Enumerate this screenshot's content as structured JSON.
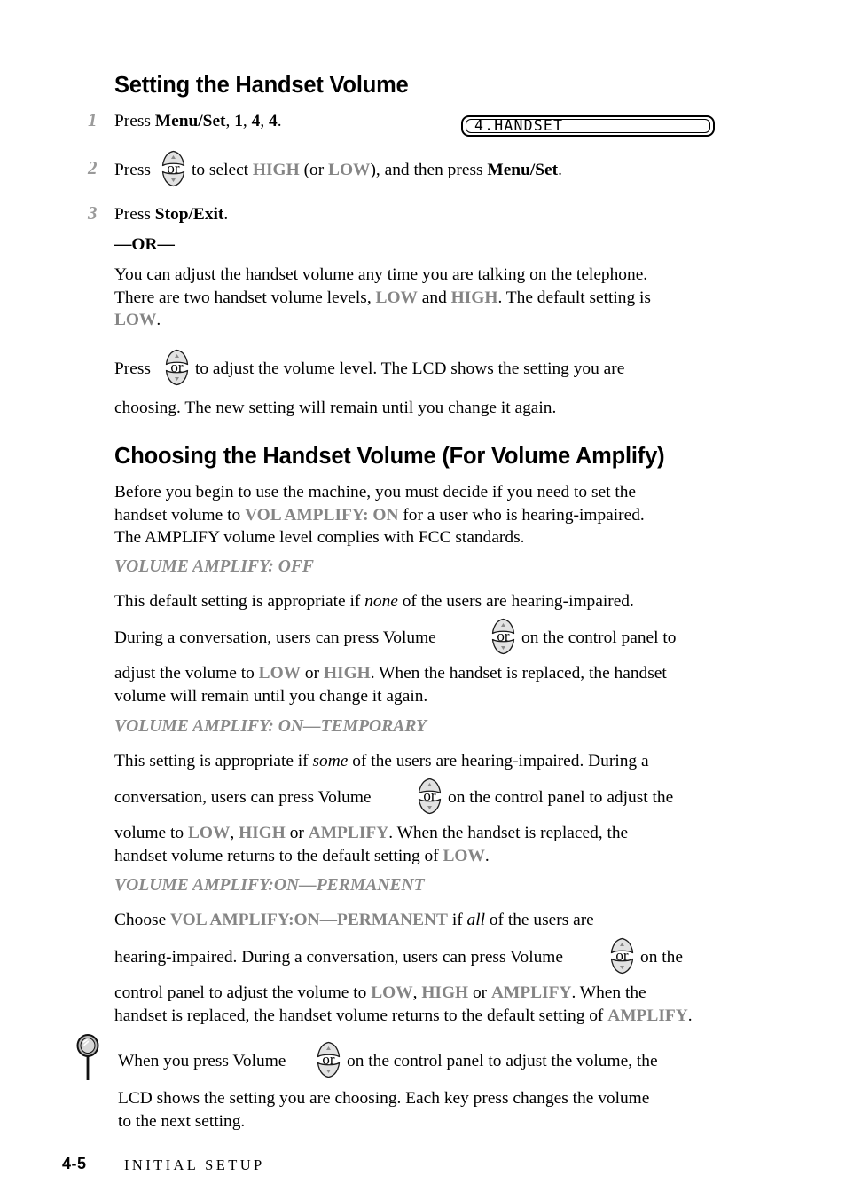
{
  "document": {
    "type": "printed-manual-page",
    "page_label": "4-5",
    "chapter_label": "INITIAL SETUP"
  },
  "section1": {
    "heading": "Setting the Handset Volume",
    "steps": [
      {
        "number": "1",
        "pre": "Press ",
        "bold1": "Menu/Set",
        "mid1": ", ",
        "bold2": "1",
        "mid2": ", ",
        "bold3": "4",
        "mid3": ", ",
        "bold4": "4",
        "tail": "."
      },
      {
        "number": "2",
        "pre": "Press",
        "after_icon": " to select ",
        "gray1": "HIGH",
        "mid1": " (or ",
        "gray2": "LOW",
        "mid2": "), and then press ",
        "bold1": "Menu/Set",
        "tail": "."
      },
      {
        "number": "3",
        "pre": "Press ",
        "bold1": "Stop/Exit",
        "tail": "."
      }
    ],
    "lcd": {
      "text": "4.HANDSET"
    },
    "or_separator": "—OR—",
    "paragraph1": {
      "line1": "You can adjust the handset volume any time you are talking on the telephone.",
      "line2_a": "There are two handset volume levels, ",
      "line2_gray1": "LOW",
      "line2_b": " and ",
      "line2_gray2": "HIGH",
      "line2_c": ". The default setting is",
      "line3_gray": "LOW",
      "line3_tail": "."
    },
    "paragraph2": {
      "pre": "Press",
      "after_icon": " to adjust the volume level. The LCD shows the setting you are",
      "line2": "choosing. The new setting will remain until you change it again."
    }
  },
  "section2": {
    "heading": "Choosing the Handset Volume (For Volume Amplify)",
    "intro": {
      "line1": "Before you begin to use the machine, you must decide if you need to set the",
      "line2_a": "handset volume to ",
      "line2_gray": "VOL AMPLIFY: ON",
      "line2_b": " for a user who is hearing-impaired.",
      "line3": "The AMPLIFY volume level complies with FCC standards."
    },
    "block_off": {
      "subhead": "VOLUME AMPLIFY: OFF",
      "p1_a": "This default setting is appropriate if ",
      "p1_italic": "none",
      "p1_b": " of the users are hearing-impaired.",
      "p2_pre": "During a conversation, users can press Volume",
      "p2_after_icon": " on the control panel to",
      "p3_a": "adjust the volume to ",
      "p3_gray1": "LOW",
      "p3_b": " or ",
      "p3_gray2": "HIGH",
      "p3_c": ". When the handset is replaced, the handset",
      "p4": "volume will remain until you change it again."
    },
    "block_temp": {
      "subhead": "VOLUME AMPLIFY: ON—TEMPORARY",
      "p1_a": "This setting is appropriate if ",
      "p1_italic": "some",
      "p1_b": " of the users are hearing-impaired. During a",
      "p2_pre": "conversation, users can press Volume",
      "p2_after_icon": " on the control panel to adjust the",
      "p3_a": "volume to ",
      "p3_gray1": "LOW",
      "p3_b": ", ",
      "p3_gray2": "HIGH",
      "p3_c": " or ",
      "p3_gray3": "AMPLIFY",
      "p3_d": ". When the handset is replaced, the",
      "p4_a": "handset volume returns to the default setting of ",
      "p4_gray": "LOW",
      "p4_b": "."
    },
    "block_perm": {
      "subhead": "VOLUME AMPLIFY:ON—PERMANENT",
      "p1_a": "Choose ",
      "p1_gray": "VOL AMPLIFY:ON—PERMANENT",
      "p1_b": " if ",
      "p1_italic": "all",
      "p1_c": " of the users are",
      "p2_pre": "hearing-impaired. During a conversation, users can press Volume",
      "p2_after_icon": " on the",
      "p3_a": "control panel to adjust the volume to ",
      "p3_gray1": "LOW",
      "p3_b": ", ",
      "p3_gray2": "HIGH",
      "p3_c": " or ",
      "p3_gray3": "AMPLIFY",
      "p3_d": ". When the",
      "p4_a": "handset is replaced, the handset volume returns to the default setting of ",
      "p4_gray": "AMPLIFY",
      "p4_b": "."
    },
    "tip": {
      "icon": "pin-icon",
      "p1_pre": "When you press Volume",
      "p1_after_icon": " on the control panel to adjust the volume, the",
      "p2": "LCD shows the setting you are choosing. Each key press changes the volume",
      "p3": "to the next setting."
    }
  },
  "icons": {
    "volume_key": {
      "name": "volume-up-down-key-icon",
      "label": "or",
      "up_glyph": "▲",
      "down_glyph": "▼"
    }
  },
  "colors": {
    "text": "#000000",
    "gray_emphasis": "#858585",
    "step_number": "#9a9a9a",
    "background": "#ffffff"
  }
}
